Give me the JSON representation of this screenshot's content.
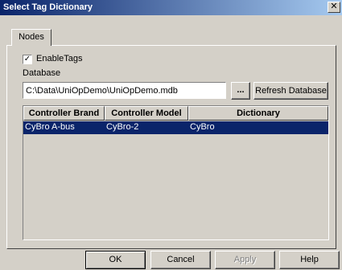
{
  "window": {
    "title": "Select Tag Dictionary",
    "close_glyph": "✕"
  },
  "tabs": [
    {
      "label": "Nodes",
      "active": true
    }
  ],
  "enable_tags": {
    "label": "EnableTags",
    "checked": true,
    "check_glyph": "✓"
  },
  "database": {
    "label": "Database",
    "value": "C:\\Data\\UniOpDemo\\UniOpDemo.mdb",
    "browse_label": "...",
    "refresh_label": "Refresh Database"
  },
  "grid": {
    "columns": [
      "Controller Brand",
      "Controller Model",
      "Dictionary"
    ],
    "rows": [
      {
        "brand": "CyBro A-bus",
        "model": "CyBro-2",
        "dictionary": "CyBro",
        "selected": true
      }
    ]
  },
  "footer": {
    "ok": "OK",
    "cancel": "Cancel",
    "apply": "Apply",
    "help": "Help"
  },
  "colors": {
    "title_bar": "#0a246a",
    "selection": "#0a246a",
    "face": "#d4d0c8"
  }
}
